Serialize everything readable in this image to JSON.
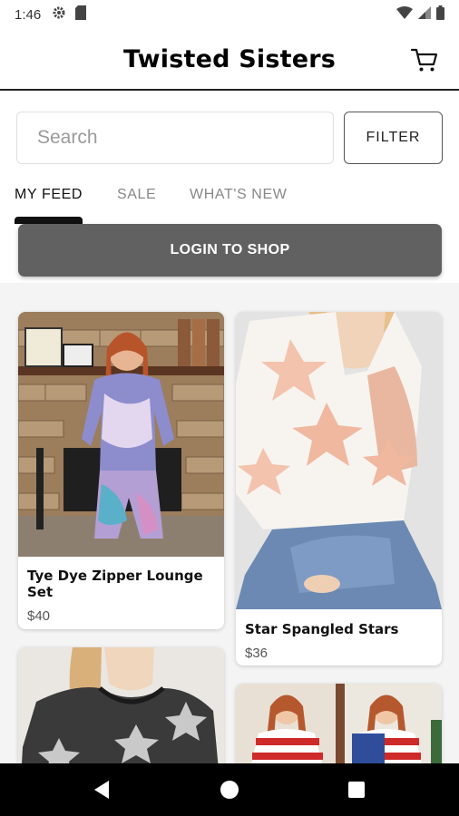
{
  "status_bar": {
    "time": "1:46",
    "icons": [
      "settings-icon",
      "sd-card-icon",
      "wifi-icon",
      "signal-icon",
      "battery-icon"
    ]
  },
  "header": {
    "title": "Twisted Sisters",
    "cart_icon": "cart-icon"
  },
  "search": {
    "placeholder": "Search",
    "value": ""
  },
  "filter": {
    "label": "FILTER"
  },
  "tabs": [
    {
      "label": "MY FEED",
      "active": true
    },
    {
      "label": "SALE",
      "active": false
    },
    {
      "label": "WHAT'S NEW",
      "active": false
    }
  ],
  "login": {
    "label": "LOGIN TO SHOP"
  },
  "products": [
    {
      "title": "Tye Dye Zipper Lounge Set",
      "price": "$40"
    },
    {
      "title": "Star Spangled Stars",
      "price": "$36"
    },
    {
      "title": "",
      "price": ""
    },
    {
      "title": "",
      "price": ""
    }
  ],
  "nav": [
    "back-icon",
    "home-icon",
    "recents-icon"
  ],
  "colors": {
    "accent": "#111111",
    "login_bg": "#616161",
    "feed_bg": "#f4f4f4"
  }
}
